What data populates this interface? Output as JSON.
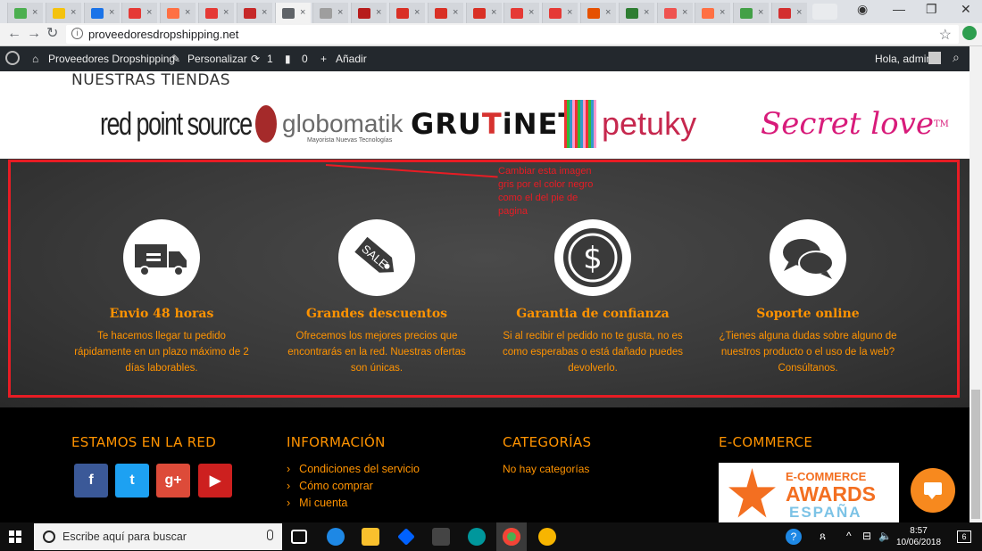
{
  "browser": {
    "tab_favicon_colors": [
      "#4caf50",
      "#f4c20d",
      "#1a73e8",
      "#e53935",
      "#ff7043",
      "#e53935",
      "#c62828",
      "#5f6368",
      "#9e9e9e",
      "#b71c1c",
      "#d93025",
      "#d93025",
      "#d93025",
      "#e53935",
      "#e53935",
      "#e65100",
      "#2e7d32",
      "#ef5350",
      "#ff7043",
      "#43a047",
      "#d32f2f"
    ],
    "tab_close_glyph": "×",
    "url": "proveedoresdropshipping.net",
    "back_glyph": "←",
    "forward_glyph": "→",
    "reload_glyph": "↻",
    "info_glyph": "i",
    "star_glyph": "☆",
    "minimize_glyph": "—",
    "restore_glyph": "❐",
    "close_glyph": "✕",
    "profile_glyph": "◉"
  },
  "wp_admin_bar": {
    "site_name": "Proveedores Dropshipping",
    "customize": "Personalizar",
    "updates_count": "1",
    "comments_count": "0",
    "add_new": "Añadir",
    "greeting": "Hola, admin",
    "icons": {
      "site": "home-icon",
      "customize": "brush-icon",
      "updates": "refresh-icon",
      "comments": "comment-icon",
      "add": "plus-icon"
    }
  },
  "stores": {
    "title": "NUESTRAS TIENDAS",
    "logos": {
      "red_point_source": "red point source",
      "globomatik": "globomatik",
      "globomatik_tagline": "Mayorista Nuevas Tecnologías",
      "grutinet_a": "GRU",
      "grutinet_b": "T",
      "grutinet_c": "i",
      "grutinet_d": "NET",
      "petuky": "petuky",
      "secret_love": "Secret love",
      "secret_love_tm": "TM"
    }
  },
  "annotation": {
    "note": "Cambiar esta imagen gris por el color negro como el del pie de pagina",
    "color": "#e81c24"
  },
  "features": [
    {
      "icon": "truck-icon",
      "title": "Envio 48 horas",
      "text": "Te hacemos llegar tu pedido rápidamente en un plazo máximo de 2 días laborables."
    },
    {
      "icon": "sale-tag-icon",
      "title": "Grandes descuentos",
      "text": "Ofrecemos los mejores precios que encontrarás en la red. Nuestras ofertas son únicas."
    },
    {
      "icon": "dollar-coin-icon",
      "title": "Garantia de confianza",
      "text": "Si al recibir el pedido no te gusta, no es como esperabas o está dañado puedes devolverlo."
    },
    {
      "icon": "chat-bubbles-icon",
      "title": "Soporte online",
      "text": "¿Tienes alguna dudas sobre alguno de nuestros producto o el uso de la web? Consúltanos."
    }
  ],
  "sale_tag_text": "SALE",
  "footer": {
    "accent": "#ff9300",
    "col1": {
      "title": "ESTAMOS EN LA RED",
      "social": [
        {
          "name": "facebook",
          "glyph": "f",
          "color": "#3b5998"
        },
        {
          "name": "twitter",
          "glyph": "t",
          "color": "#1da1f2"
        },
        {
          "name": "google-plus",
          "glyph": "g+",
          "color": "#dd4b39"
        },
        {
          "name": "youtube",
          "glyph": "▶",
          "color": "#cd201f"
        }
      ]
    },
    "col2": {
      "title": "INFORMACIÓN",
      "links": [
        "Condiciones del servicio",
        "Cómo comprar",
        "Mi cuenta"
      ],
      "chevron": "›"
    },
    "col3": {
      "title": "CATEGORÍAS",
      "empty": "No hay categorías"
    },
    "col4": {
      "title": "E-COMMERCE",
      "award": {
        "line1": "E-COMMERCE",
        "line2": "AWARDS",
        "line3": "ESPAÑA"
      }
    }
  },
  "taskbar": {
    "search_placeholder": "Escribe aquí para buscar",
    "time": "8:57",
    "date": "10/06/2018",
    "notifications": "6",
    "tray_glyphs": {
      "help": "?",
      "people": "ጸ",
      "up": "^",
      "network": "⊟",
      "volume": "🔈"
    },
    "app_colors": {
      "edge": "#1e88e5",
      "explorer": "#f9c02d",
      "dropbox": "#0061fe",
      "store": "#444",
      "arduino": "#00979c",
      "chrome": "#4caf50",
      "other": "#f7b500"
    }
  }
}
